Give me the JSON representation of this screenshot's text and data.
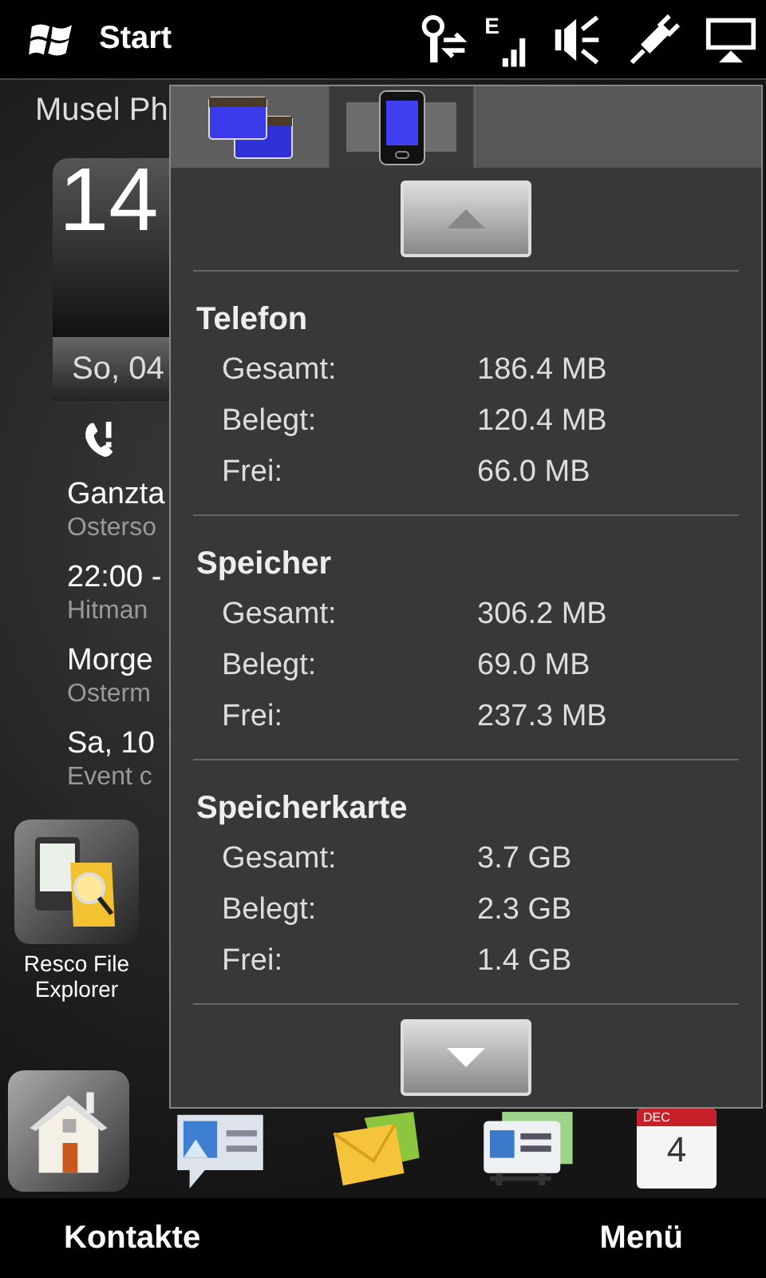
{
  "status_bar": {
    "start_label": "Start",
    "network_type": "E"
  },
  "home": {
    "owner": "Musel Ph",
    "clock": "14",
    "date": "So, 04",
    "appointments": [
      {
        "title": "Ganzta",
        "detail": "Osterso"
      },
      {
        "title": "22:00 -",
        "detail": "Hitman"
      },
      {
        "title": "Morge",
        "detail": "Osterm"
      },
      {
        "title": "Sa, 10",
        "detail": "Event c"
      }
    ],
    "shortcut": {
      "label_lines": [
        "Resco File",
        "Explorer"
      ]
    },
    "calendar_icon": {
      "month": "DEC",
      "day": "4"
    }
  },
  "popup": {
    "tabs": [
      {
        "kind": "windows",
        "selected": false
      },
      {
        "kind": "phone",
        "selected": true
      }
    ],
    "sections": [
      {
        "title": "Telefon",
        "rows": [
          {
            "label": "Gesamt:",
            "value": "186.4 MB"
          },
          {
            "label": "Belegt:",
            "value": "120.4 MB"
          },
          {
            "label": "Frei:",
            "value": "66.0 MB"
          }
        ]
      },
      {
        "title": "Speicher",
        "rows": [
          {
            "label": "Gesamt:",
            "value": "306.2 MB"
          },
          {
            "label": "Belegt:",
            "value": "69.0 MB"
          },
          {
            "label": "Frei:",
            "value": "237.3 MB"
          }
        ]
      },
      {
        "title": "Speicherkarte",
        "rows": [
          {
            "label": "Gesamt:",
            "value": "3.7 GB"
          },
          {
            "label": "Belegt:",
            "value": "2.3 GB"
          },
          {
            "label": "Frei:",
            "value": "1.4 GB"
          }
        ]
      }
    ]
  },
  "softkeys": [
    "Kontakte",
    "Menü"
  ]
}
